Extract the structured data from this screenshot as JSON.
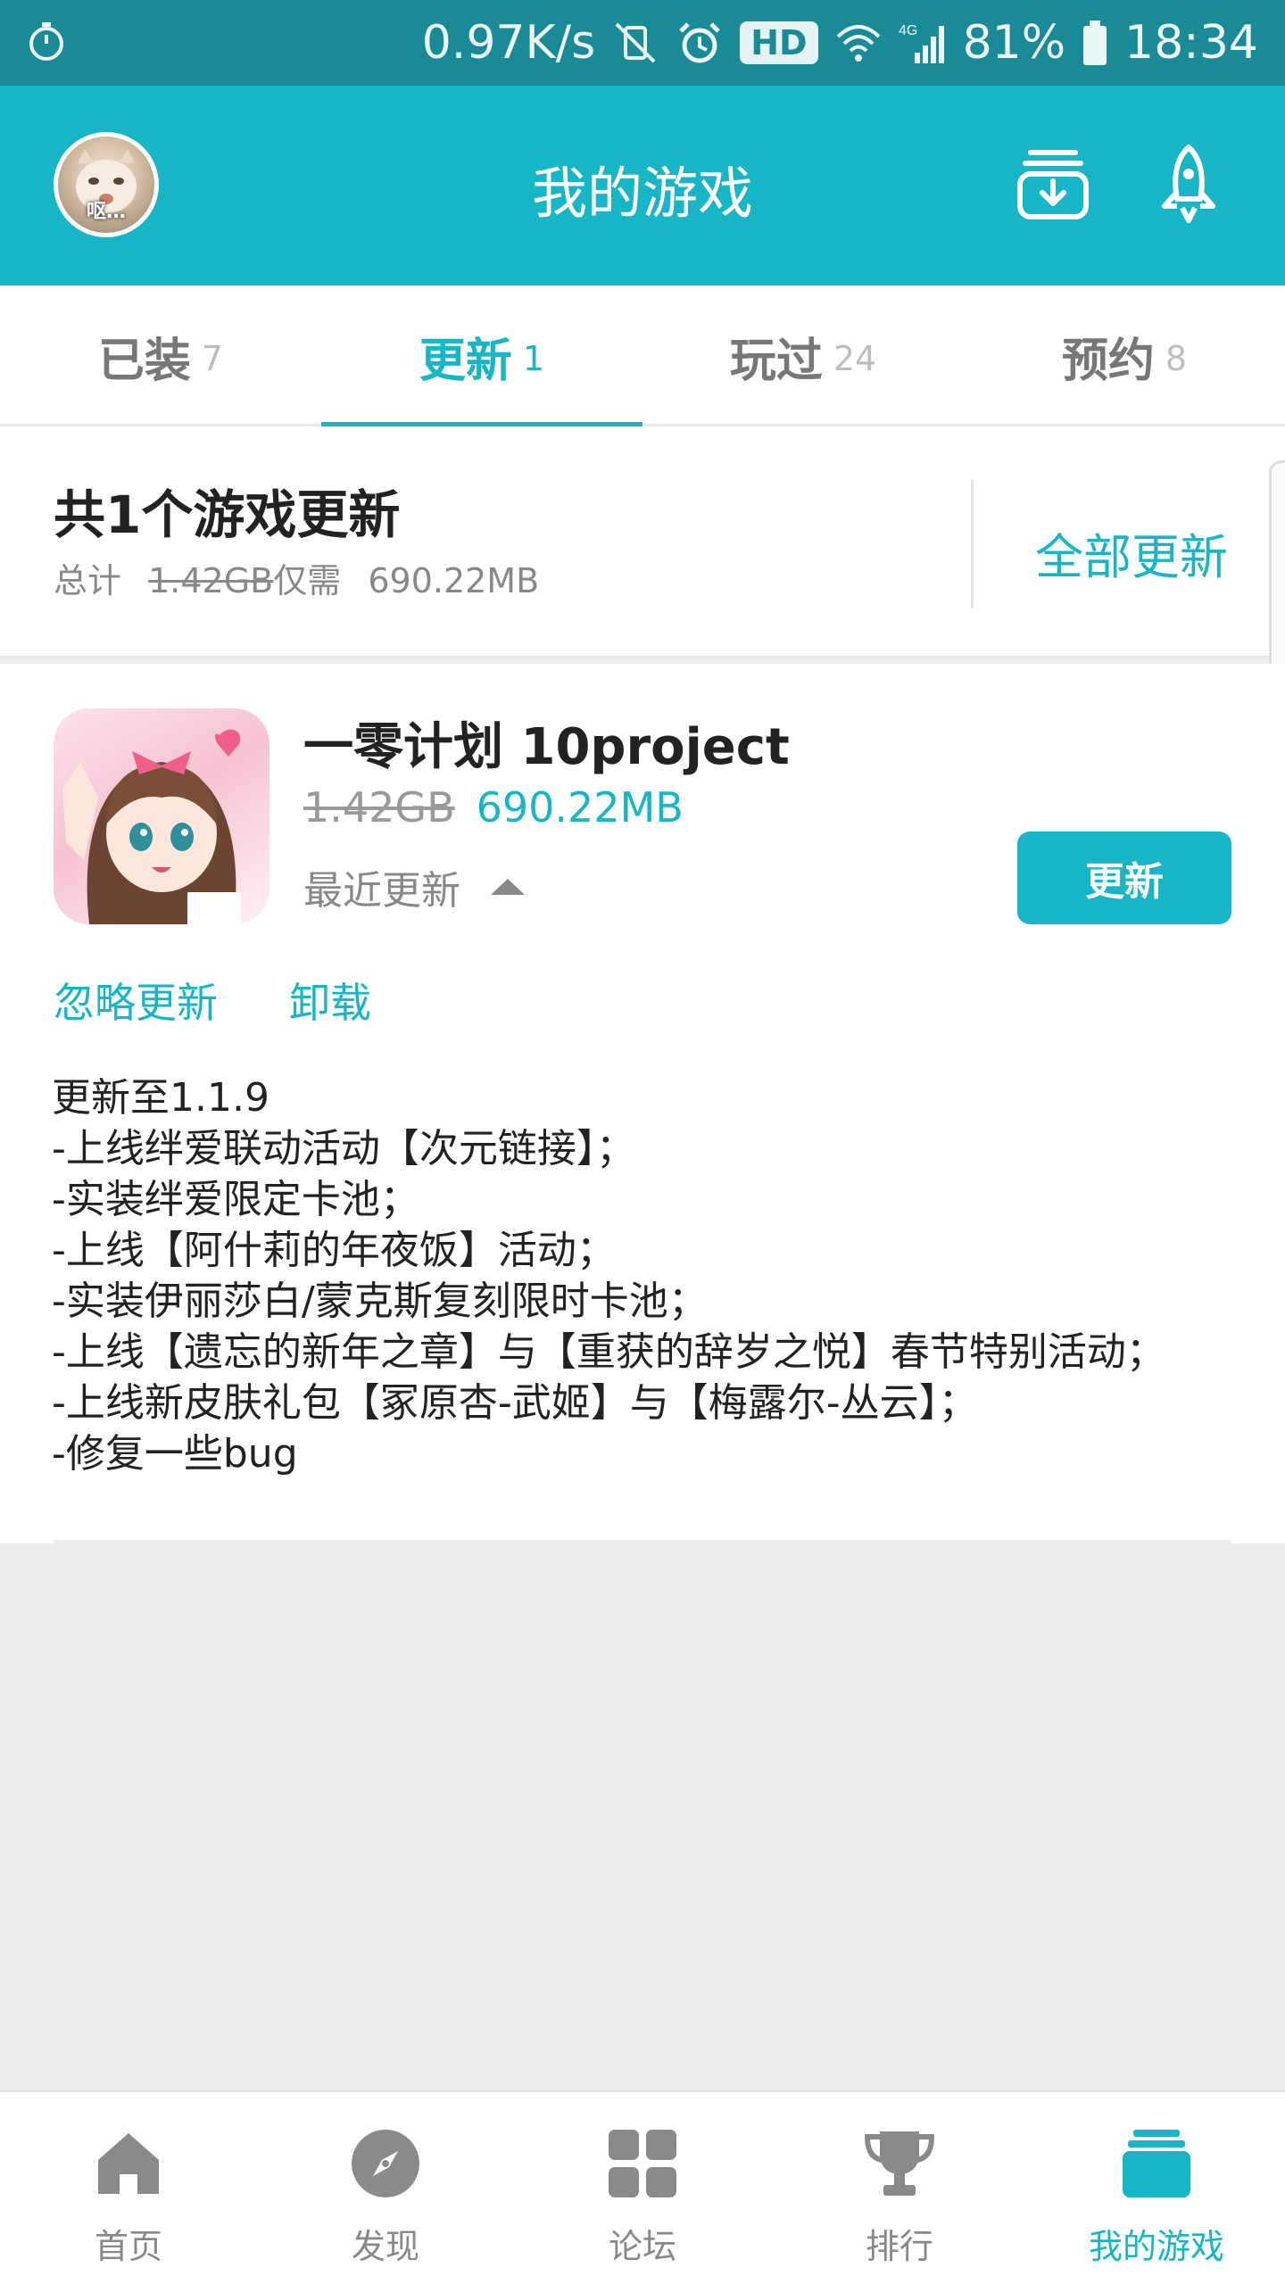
{
  "status_bar": {
    "net_speed": "0.97K/s",
    "hd_badge": "HD",
    "network": "4G",
    "battery": "81%",
    "time": "18:34"
  },
  "header": {
    "avatar_caption": "呕…",
    "title": "我的游戏",
    "icons": [
      "download-tray-icon",
      "rocket-icon"
    ]
  },
  "tabs": [
    {
      "label": "已装",
      "count": "7"
    },
    {
      "label": "更新",
      "count": "1",
      "active": true
    },
    {
      "label": "玩过",
      "count": "24"
    },
    {
      "label": "预约",
      "count": "8"
    }
  ],
  "summary": {
    "title": "共1个游戏更新",
    "total_label": "总计",
    "old_size": "1.42GB",
    "only_need": "仅需",
    "new_size": "690.22MB",
    "update_all": "全部更新"
  },
  "game": {
    "name": "一零计划 10project",
    "old_size": "1.42GB",
    "new_size": "690.22MB",
    "recent_update": "最近更新",
    "update_button": "更新",
    "ignore": "忽略更新",
    "uninstall": "卸载",
    "changelog": [
      "更新至1.1.9",
      "-上线绊爱联动活动【次元链接】；",
      "-实装绊爱限定卡池；",
      "-上线【阿什莉的年夜饭】活动；",
      "-实装伊丽莎白/蒙克斯复刻限时卡池；",
      "-上线【遗忘的新年之章】与【重获的辞岁之悦】春节特别活动；",
      "-上线新皮肤礼包【冢原杏-武姬】与【梅露尔-丛云】；",
      "-修复一些bug"
    ]
  },
  "bottom_nav": [
    {
      "label": "首页",
      "icon": "home-icon"
    },
    {
      "label": "发现",
      "icon": "compass-icon"
    },
    {
      "label": "论坛",
      "icon": "grid-icon"
    },
    {
      "label": "排行",
      "icon": "trophy-icon"
    },
    {
      "label": "我的游戏",
      "icon": "stack-icon",
      "active": true
    }
  ],
  "colors": {
    "accent": "#17b6c6",
    "status_bar": "#1a8a96",
    "background": "#ededed"
  }
}
